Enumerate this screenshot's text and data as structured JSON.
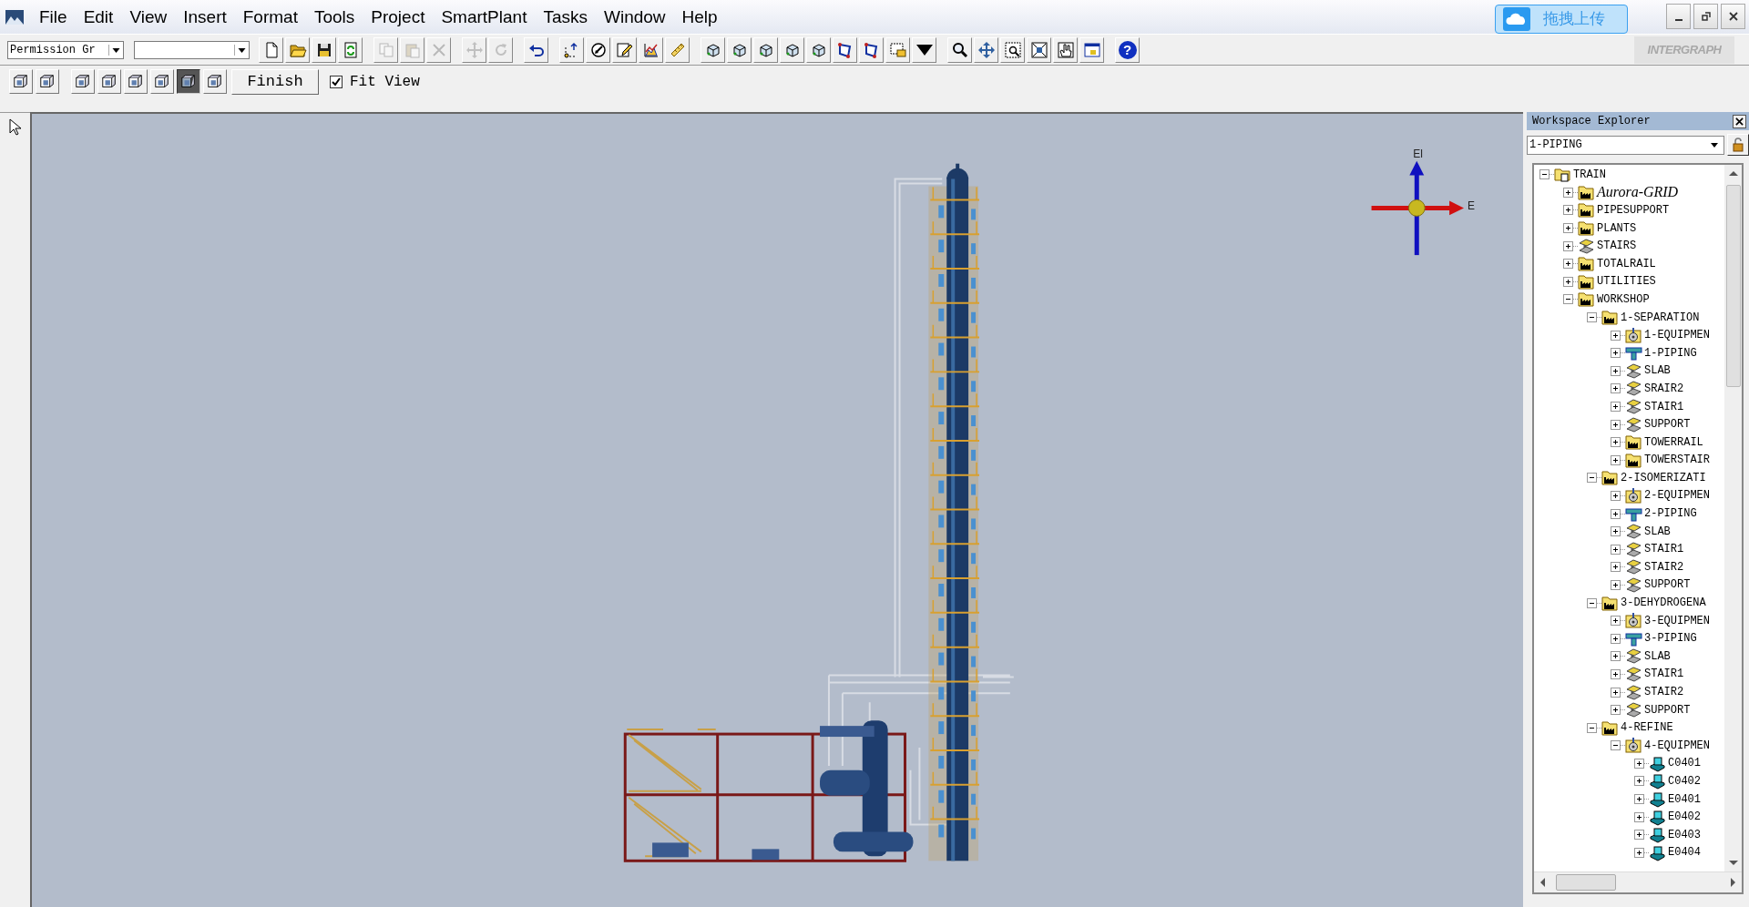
{
  "menu": [
    "File",
    "Edit",
    "View",
    "Insert",
    "Format",
    "Tools",
    "Project",
    "SmartPlant",
    "Tasks",
    "Window",
    "Help"
  ],
  "upload_button": {
    "label": "拖拽上传"
  },
  "logo": {
    "text": "INTERGRAPH"
  },
  "toolbar_1": {
    "permission_group": "Permission Gr",
    "buttons": [
      {
        "kind": "new",
        "disabled": false
      },
      {
        "kind": "open",
        "disabled": false
      },
      {
        "kind": "save",
        "disabled": false
      },
      {
        "kind": "refresh",
        "disabled": false
      },
      {
        "kind": "copy",
        "disabled": true
      },
      {
        "kind": "paste",
        "disabled": true
      },
      {
        "kind": "delete",
        "disabled": true
      },
      {
        "kind": "move",
        "disabled": true
      },
      {
        "kind": "rotate",
        "disabled": true
      },
      {
        "kind": "undo",
        "disabled": false
      },
      {
        "kind": "points",
        "disabled": false
      },
      {
        "kind": "measure",
        "disabled": false
      },
      {
        "kind": "pencil",
        "disabled": false
      },
      {
        "kind": "chart",
        "disabled": false
      },
      {
        "kind": "ruler",
        "disabled": false
      },
      {
        "kind": "cube",
        "disabled": false
      },
      {
        "kind": "cube",
        "disabled": false
      },
      {
        "kind": "cube",
        "disabled": false
      },
      {
        "kind": "cube",
        "disabled": false
      },
      {
        "kind": "cube",
        "disabled": false
      },
      {
        "kind": "frame",
        "disabled": false
      },
      {
        "kind": "frame",
        "disabled": false
      },
      {
        "kind": "selection",
        "disabled": false
      },
      {
        "kind": "caret",
        "disabled": false
      },
      {
        "kind": "zoom",
        "disabled": false
      },
      {
        "kind": "pan",
        "disabled": false
      },
      {
        "kind": "zoomarea",
        "disabled": false
      },
      {
        "kind": "fit",
        "disabled": false
      },
      {
        "kind": "hand",
        "disabled": false
      },
      {
        "kind": "window",
        "disabled": false
      },
      {
        "kind": "help",
        "disabled": false,
        "label": "?"
      }
    ]
  },
  "toolbar_2": {
    "views": [
      {
        "selected": false
      },
      {
        "selected": false
      },
      {
        "selected": false
      },
      {
        "selected": false
      },
      {
        "selected": false
      },
      {
        "selected": false
      },
      {
        "selected": true
      },
      {
        "selected": false
      }
    ],
    "finish_button": "Finish",
    "fit_view": {
      "label": "Fit View",
      "checked": true
    }
  },
  "viewport": {
    "compass": {
      "up_label": "El",
      "east_label": "E"
    }
  },
  "workspace_explorer": {
    "title": "Workspace Explorer",
    "filter": "1-PIPING",
    "tree": [
      {
        "label": "TRAIN",
        "kind": "system",
        "expanded": true,
        "children": [
          {
            "label": "Aurora-GRID",
            "kind": "plant",
            "expanded": false,
            "italic": true
          },
          {
            "label": "PIPESUPPORT",
            "kind": "plant",
            "expanded": false
          },
          {
            "label": "PLANTS",
            "kind": "plant",
            "expanded": false
          },
          {
            "label": "STAIRS",
            "kind": "structure",
            "expanded": false
          },
          {
            "label": "TOTALRAIL",
            "kind": "plant",
            "expanded": false
          },
          {
            "label": "UTILITIES",
            "kind": "plant",
            "expanded": false
          },
          {
            "label": "WORKSHOP",
            "kind": "plant",
            "expanded": true,
            "children": [
              {
                "label": "1-SEPARATION",
                "kind": "plant",
                "expanded": true,
                "children": [
                  {
                    "label": "1-EQUIPMEN",
                    "kind": "equipment",
                    "expanded": false
                  },
                  {
                    "label": "1-PIPING",
                    "kind": "piping",
                    "expanded": false
                  },
                  {
                    "label": "SLAB",
                    "kind": "structure",
                    "expanded": false
                  },
                  {
                    "label": "SRAIR2",
                    "kind": "structure",
                    "expanded": false
                  },
                  {
                    "label": "STAIR1",
                    "kind": "structure",
                    "expanded": false
                  },
                  {
                    "label": "SUPPORT",
                    "kind": "structure",
                    "expanded": false
                  },
                  {
                    "label": "TOWERRAIL",
                    "kind": "plant",
                    "expanded": false
                  },
                  {
                    "label": "TOWERSTAIR",
                    "kind": "plant",
                    "expanded": false
                  }
                ]
              },
              {
                "label": "2-ISOMERIZATI",
                "kind": "plant",
                "expanded": true,
                "children": [
                  {
                    "label": "2-EQUIPMEN",
                    "kind": "equipment",
                    "expanded": false
                  },
                  {
                    "label": "2-PIPING",
                    "kind": "piping",
                    "expanded": false
                  },
                  {
                    "label": "SLAB",
                    "kind": "structure",
                    "expanded": false
                  },
                  {
                    "label": "STAIR1",
                    "kind": "structure",
                    "expanded": false
                  },
                  {
                    "label": "STAIR2",
                    "kind": "structure",
                    "expanded": false
                  },
                  {
                    "label": "SUPPORT",
                    "kind": "structure",
                    "expanded": false
                  }
                ]
              },
              {
                "label": "3-DEHYDROGENA",
                "kind": "plant",
                "expanded": true,
                "children": [
                  {
                    "label": "3-EQUIPMEN",
                    "kind": "equipment",
                    "expanded": false
                  },
                  {
                    "label": "3-PIPING",
                    "kind": "piping",
                    "expanded": false
                  },
                  {
                    "label": "SLAB",
                    "kind": "structure",
                    "expanded": false
                  },
                  {
                    "label": "STAIR1",
                    "kind": "structure",
                    "expanded": false
                  },
                  {
                    "label": "STAIR2",
                    "kind": "structure",
                    "expanded": false
                  },
                  {
                    "label": "SUPPORT",
                    "kind": "structure",
                    "expanded": false
                  }
                ]
              },
              {
                "label": "4-REFINE",
                "kind": "plant",
                "expanded": true,
                "children": [
                  {
                    "label": "4-EQUIPMEN",
                    "kind": "equipment",
                    "expanded": true,
                    "children": [
                      {
                        "label": "C0401",
                        "kind": "machine",
                        "expanded": false
                      },
                      {
                        "label": "C0402",
                        "kind": "machine",
                        "expanded": false
                      },
                      {
                        "label": "E0401",
                        "kind": "machine",
                        "expanded": false
                      },
                      {
                        "label": "E0402",
                        "kind": "machine",
                        "expanded": false
                      },
                      {
                        "label": "E0403",
                        "kind": "machine",
                        "expanded": false
                      },
                      {
                        "label": "E0404",
                        "kind": "machine",
                        "expanded": false
                      }
                    ]
                  }
                ]
              }
            ]
          }
        ]
      }
    ]
  }
}
